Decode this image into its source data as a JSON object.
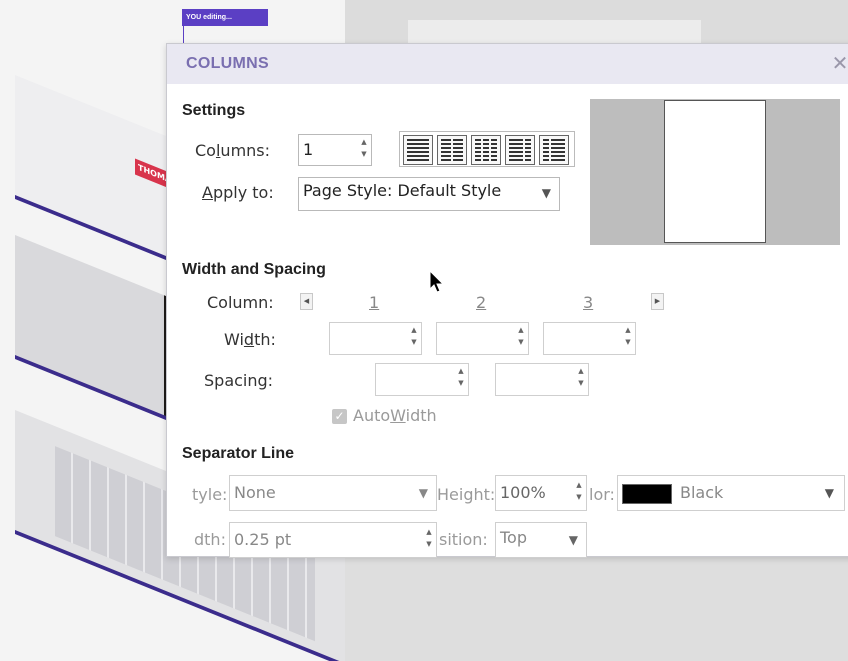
{
  "background": {
    "badge_text": "YOU editing...",
    "slide_label": "THOMA"
  },
  "dialog": {
    "title": "COLUMNS",
    "settings": {
      "heading": "Settings",
      "columns_label_pre": "Co",
      "columns_label_ul": "l",
      "columns_label_post": "umns:",
      "columns_value": "1",
      "apply_label_ul": "A",
      "apply_label_post": "pply to:",
      "apply_value": "Page Style: Default Style"
    },
    "width_spacing": {
      "heading": "Width and Spacing",
      "column_label": "Column:",
      "col_numbers": [
        "1",
        "2",
        "3"
      ],
      "width_label_pre": "Wi",
      "width_label_ul": "d",
      "width_label_post": "th:",
      "spacing_label": "Spacing:",
      "autowidth_pre": "Auto",
      "autowidth_ul": "W",
      "autowidth_post": "idth"
    },
    "separator": {
      "heading": "Separator Line",
      "style_label": "tyle:",
      "style_value": "None",
      "height_label": "Height:",
      "height_value": "100%",
      "color_label": "lor:",
      "color_value": "Black",
      "width_label": "dth:",
      "width_value": "0.25 pt",
      "position_label": "sition:",
      "position_value": "Top"
    }
  },
  "colors": {
    "title": "#7a6fb0",
    "titlebar": "#e9e8f2",
    "badge": "#5b3fc4"
  }
}
